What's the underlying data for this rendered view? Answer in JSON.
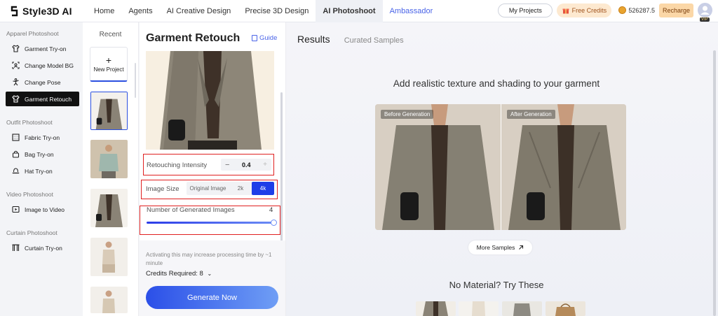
{
  "app": {
    "logo_text": "Style3D AI"
  },
  "nav": {
    "items": [
      "Home",
      "Agents",
      "AI Creative Design",
      "Precise 3D Design",
      "AI Photoshoot",
      "Ambassador"
    ],
    "active": "AI Photoshoot"
  },
  "header": {
    "my_projects": "My Projects",
    "free_credits": "Free Credits",
    "balance": "526287.5",
    "recharge": "Recharge",
    "vip_badge": "VIP"
  },
  "sidebar": {
    "sections": [
      {
        "title": "Apparel Photoshoot",
        "items": [
          "Garment Try-on",
          "Change Model BG",
          "Change Pose",
          "Garment Retouch"
        ]
      },
      {
        "title": "Outfit Photoshoot",
        "items": [
          "Fabric Try-on",
          "Bag Try-on",
          "Hat Try-on"
        ]
      },
      {
        "title": "Video Photoshoot",
        "items": [
          "Image to Video"
        ]
      },
      {
        "title": "Curtain Photoshoot",
        "items": [
          "Curtain Try-on"
        ]
      }
    ],
    "active_item": "Garment Retouch"
  },
  "recent": {
    "title": "Recent",
    "new_project": "New Project"
  },
  "panel": {
    "title": "Garment Retouch",
    "guide": "Guide",
    "retouching_label": "Retouching Intensity",
    "retouching_value": "0.4",
    "image_size_label": "Image Size",
    "size_options": [
      "Original Image",
      "2k",
      "4k"
    ],
    "size_selected": "4k",
    "generated_label": "Number of Generated Images",
    "generated_count": "4",
    "slider_fraction": 1.0,
    "note": "Activating this may increase processing time by ~1 minute",
    "credits_required": "Credits Required: 8",
    "generate_button": "Generate Now"
  },
  "results": {
    "tab_active": "Results",
    "tab_other": "Curated Samples",
    "headline": "Add realistic texture and shading to your garment",
    "before_label": "Before Generation",
    "after_label": "After Generation",
    "more_samples": "More Samples",
    "no_material": "No Material? Try These"
  },
  "colors": {
    "accent": "#1e3ee8",
    "highlight": "#e02020",
    "credits_bg": "#fde9d0",
    "recharge_bg": "#fbd7a7"
  }
}
